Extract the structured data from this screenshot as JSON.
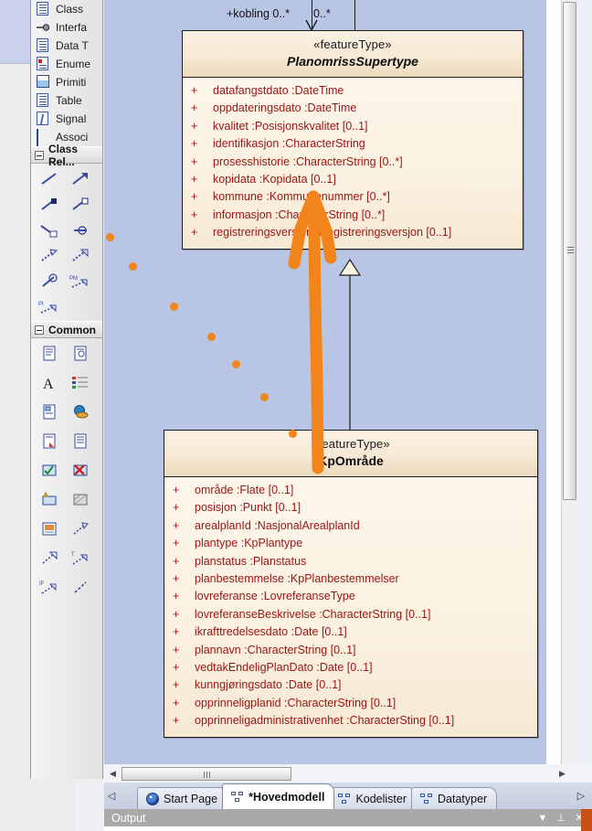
{
  "app": {
    "diagram_background_color": "#b9c5e4",
    "class_fill_color": "#fbf0de",
    "attribute_text_color": "#9a1414",
    "annotation_color": "#f1841a"
  },
  "toolbox": {
    "items": [
      {
        "label": "Class",
        "icon": "class-icon"
      },
      {
        "label": "Interfa",
        "icon": "interface-icon"
      },
      {
        "label": "Data T",
        "icon": "datatype-icon"
      },
      {
        "label": "Enume",
        "icon": "enumeration-icon"
      },
      {
        "label": "Primiti",
        "icon": "primitive-icon"
      },
      {
        "label": "Table",
        "icon": "table-icon"
      },
      {
        "label": "Signal",
        "icon": "signal-icon"
      },
      {
        "label": "Associ",
        "icon": "association-icon"
      }
    ],
    "sections": [
      {
        "label": "Class Rel...",
        "expander": "collapse-toggle"
      },
      {
        "label": "Common",
        "expander": "collapse-toggle"
      }
    ],
    "class_relationship_icons": [
      "associate-icon",
      "generalize-icon",
      "compose-icon",
      "aggregate-icon",
      "assoc-class-icon",
      "nesting-icon",
      "dependency-icon",
      "realize-icon",
      "trace-icon",
      "package-import-icon",
      "package-merge-icon"
    ],
    "common_icons": [
      "note-icon",
      "note-link-icon",
      "text-icon",
      "legend-icon",
      "diagram-ref-icon",
      "web-hyperlink-icon",
      "constraint-icon",
      "document-icon",
      "checklist-icon",
      "cancel-icon",
      "artifact-icon",
      "pattern-icon",
      "image-icon",
      "connector-icon",
      "dependency2-icon",
      "trace2-icon",
      "information-flow-icon",
      "line-icon"
    ]
  },
  "diagram": {
    "association": {
      "source_role": "+kobling 0..*",
      "target_role": "0..*"
    },
    "classes": [
      {
        "stereotype": "«featureType»",
        "name": "PlanomrissSupertype",
        "abstract": true,
        "attributes": [
          {
            "visibility": "+",
            "text": "datafangstdato  :DateTime"
          },
          {
            "visibility": "+",
            "text": "oppdateringsdato  :DateTime"
          },
          {
            "visibility": "+",
            "text": "kvalitet  :Posisjonskvalitet [0..1]"
          },
          {
            "visibility": "+",
            "text": "identifikasjon  :CharacterString"
          },
          {
            "visibility": "+",
            "text": "prosesshistorie  :CharacterString [0..*]"
          },
          {
            "visibility": "+",
            "text": "kopidata  :Kopidata [0..1]"
          },
          {
            "visibility": "+",
            "text": "kommune  :Kommunenummer [0..*]"
          },
          {
            "visibility": "+",
            "text": "informasjon  :CharacterString [0..*]"
          },
          {
            "visibility": "+",
            "text": "registreringsversjon  :Registreringsversjon [0..1]"
          }
        ]
      },
      {
        "stereotype": "«featureType»",
        "name": "KpOmråde",
        "abstract": false,
        "attributes": [
          {
            "visibility": "+",
            "text": "område  :Flate [0..1]"
          },
          {
            "visibility": "+",
            "text": "posisjon  :Punkt [0..1]"
          },
          {
            "visibility": "+",
            "text": "arealplanId  :NasjonalArealplanId"
          },
          {
            "visibility": "+",
            "text": "plantype  :KpPlantype"
          },
          {
            "visibility": "+",
            "text": "planstatus  :Planstatus"
          },
          {
            "visibility": "+",
            "text": "planbestemmelse  :KpPlanbestemmelser"
          },
          {
            "visibility": "+",
            "text": "lovreferanse  :LovreferanseType"
          },
          {
            "visibility": "+",
            "text": "lovreferanseBeskrivelse  :CharacterString [0..1]"
          },
          {
            "visibility": "+",
            "text": "ikrafttredelsesdato  :Date [0..1]"
          },
          {
            "visibility": "+",
            "text": "plannavn  :CharacterString [0..1]"
          },
          {
            "visibility": "+",
            "text": "vedtakEndeligPlanDato  :Date [0..1]"
          },
          {
            "visibility": "+",
            "text": "kunngjøringsdato  :Date [0..1]"
          },
          {
            "visibility": "+",
            "text": "opprinneligplanid  :CharacterString [0..1]"
          },
          {
            "visibility": "+",
            "text": "opprinneligadministrativenhet  :CharacterSting [0..1]"
          }
        ]
      }
    ]
  },
  "tabs": [
    {
      "label": "Start Page",
      "icon": "start-page-icon",
      "active": false
    },
    {
      "label": "*Hovedmodell",
      "icon": "diagram-icon",
      "active": true
    },
    {
      "label": "Kodelister",
      "icon": "diagram-icon",
      "active": false
    },
    {
      "label": "Datatyper",
      "icon": "diagram-icon",
      "active": false
    }
  ],
  "output_panel": {
    "title": "Output",
    "buttons": [
      "dropdown-icon",
      "pin-icon",
      "close-icon"
    ]
  },
  "scroll": {
    "left_arrow": "◀",
    "right_arrow": "▶",
    "tab_prev": "◁",
    "tab_next": "▷"
  }
}
